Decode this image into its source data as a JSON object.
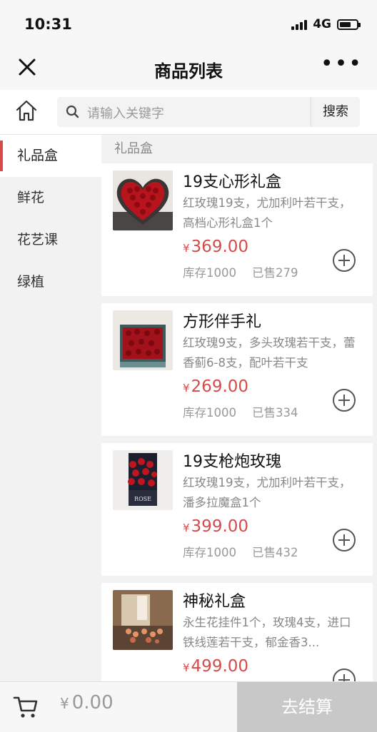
{
  "status_bar": {
    "time": "10:31",
    "network": "4G",
    "battery_level": 0.7
  },
  "navbar": {
    "title": "商品列表",
    "more": "•••"
  },
  "search": {
    "placeholder": "请输入关键字",
    "button_label": "搜索"
  },
  "sidebar": {
    "categories": [
      {
        "label": "礼品盒",
        "active": true
      },
      {
        "label": "鲜花",
        "active": false
      },
      {
        "label": "花艺课",
        "active": false
      },
      {
        "label": "绿植",
        "active": false
      }
    ]
  },
  "main": {
    "section_title": "礼品盒",
    "products": [
      {
        "name": "19支心形礼盒",
        "desc": "红玫瑰19支，尤加利叶若干支，高档心形礼盒1个",
        "currency": "¥",
        "price": "369.00",
        "stock": "库存1000",
        "sold": "已售279"
      },
      {
        "name": "方形伴手礼",
        "desc": "红玫瑰9支，多头玫瑰若干支，蕾香蓟6-8支，配叶若干支",
        "currency": "¥",
        "price": "269.00",
        "stock": "库存1000",
        "sold": "已售334"
      },
      {
        "name": "19支枪炮玫瑰",
        "desc": "红玫瑰19支，尤加利叶若干支，潘多拉魔盒1个",
        "currency": "¥",
        "price": "399.00",
        "stock": "库存1000",
        "sold": "已售432"
      },
      {
        "name": "神秘礼盒",
        "desc": "永生花挂件1个，玫瑰4支，进口铁线莲若干支，郁金香3...",
        "currency": "¥",
        "price": "499.00",
        "stock": "",
        "sold": ""
      }
    ],
    "thumb_labels": [
      "ROSE"
    ]
  },
  "bottom_bar": {
    "currency": "¥",
    "total": "0.00",
    "checkout_label": "去结算"
  },
  "colors": {
    "accent": "#d84a4a",
    "price": "#d54b4b",
    "checkout_disabled": "#c8c8c8"
  }
}
